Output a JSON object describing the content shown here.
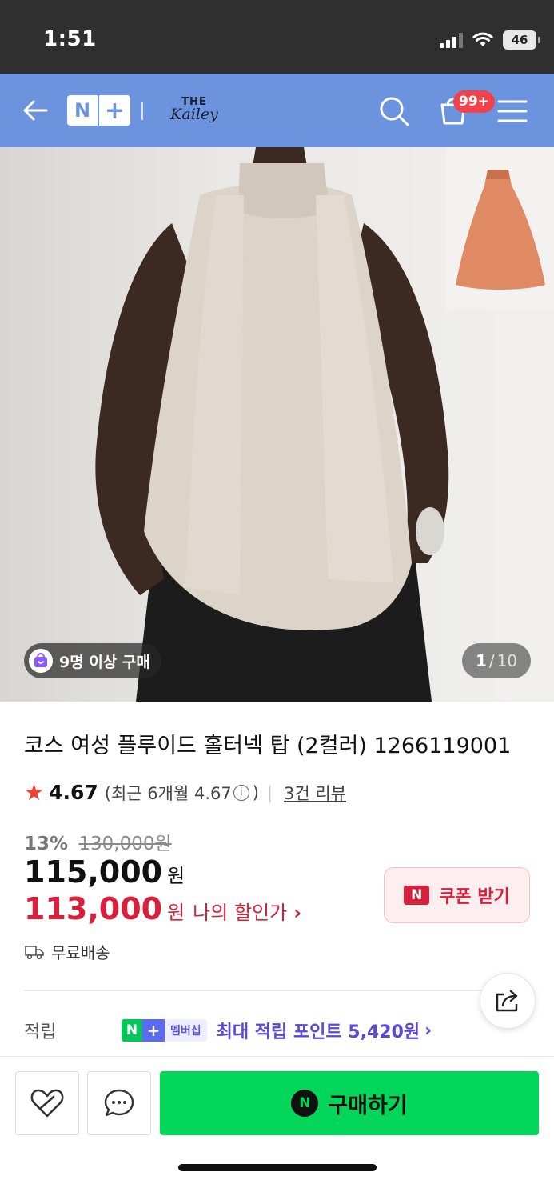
{
  "status_bar": {
    "time": "1:51",
    "battery": "46"
  },
  "header": {
    "logo_n": "N",
    "logo_plus": "+",
    "store_logo_top": "THE",
    "store_logo_name": "Kailey",
    "cart_badge": "99+"
  },
  "gallery": {
    "buyers_badge": "9명 이상 구매",
    "current": "1",
    "separator": "/",
    "total": "10"
  },
  "product": {
    "title": "코스 여성 플루이드 홀터넥 탑 (2컬러) 1266119001",
    "rating": "4.67",
    "rating_recent_prefix": "(최근 6개월 4.67",
    "rating_recent_suffix": ")",
    "info_glyph": "i",
    "review_link": "3건 리뷰",
    "discount_pct": "13%",
    "original_price": "130,000원",
    "price": "115,000",
    "price_unit": "원",
    "my_price": "113,000",
    "my_price_unit": "원",
    "my_price_label": "나의 할인가",
    "coupon_mark": "N",
    "coupon_label": "쿠폰 받기",
    "shipping": "무료배송"
  },
  "points": {
    "label": "적립",
    "badge_n": "N",
    "badge_plus": "+",
    "badge_text": "멤버십",
    "text": "최대 적립 포인트 5,420원"
  },
  "bottom_bar": {
    "buy_mark": "N",
    "buy_label": "구매하기"
  },
  "colors": {
    "header_bg": "#6c94de",
    "accent_red": "#d91f3a",
    "naver_green": "#03d65a",
    "points_purple": "#5b48d8"
  }
}
